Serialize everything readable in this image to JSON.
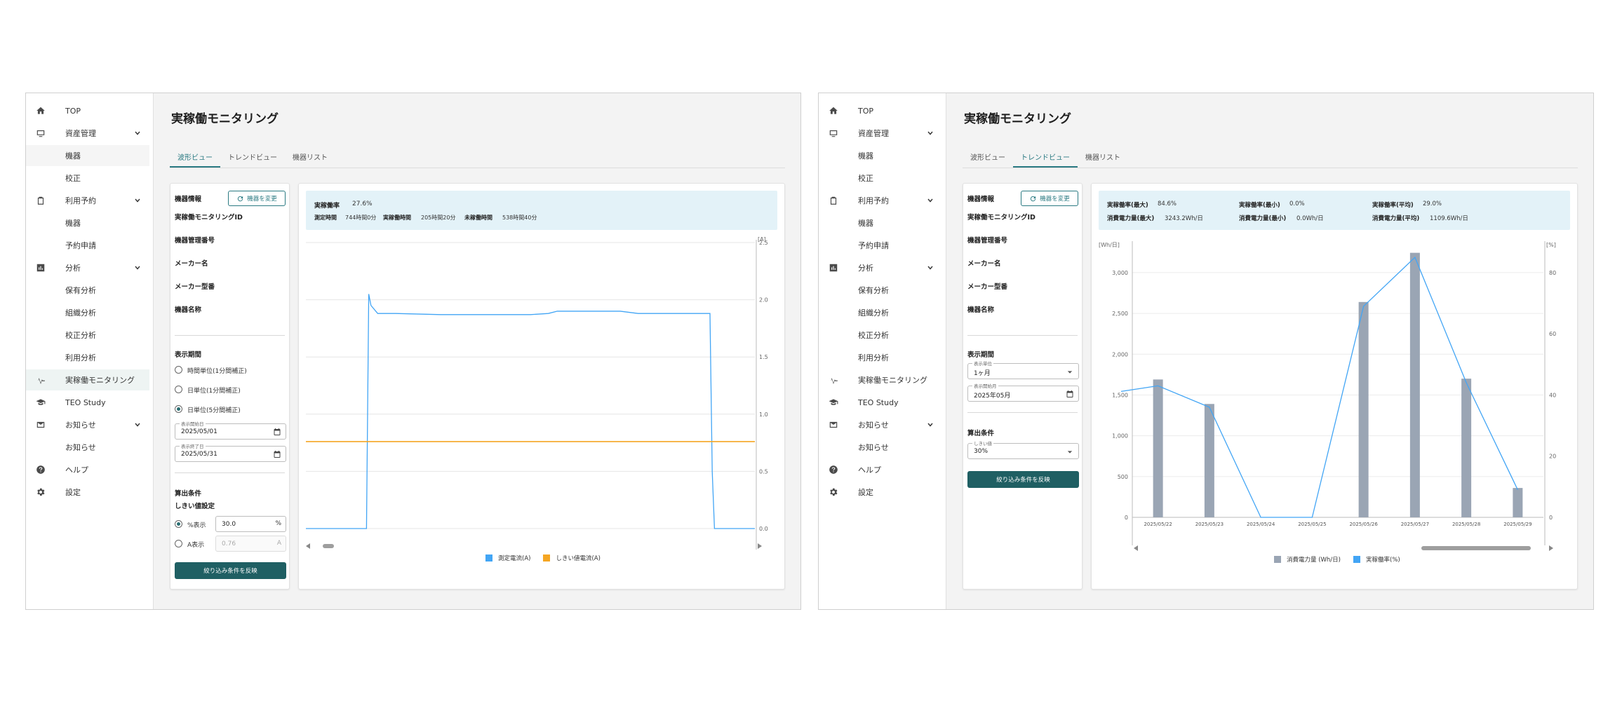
{
  "sidebar": {
    "items": [
      {
        "label": "TOP",
        "icon": "home-icon"
      },
      {
        "label": "資産管理",
        "icon": "asset-icon",
        "expandable": true
      },
      {
        "label": "機器"
      },
      {
        "label": "校正"
      },
      {
        "label": "利用予約",
        "icon": "clipboard-icon",
        "expandable": true
      },
      {
        "label": "機器"
      },
      {
        "label": "予約申請"
      },
      {
        "label": "分析",
        "icon": "analytics-icon",
        "expandable": true
      },
      {
        "label": "保有分析"
      },
      {
        "label": "組織分析"
      },
      {
        "label": "校正分析"
      },
      {
        "label": "利用分析"
      },
      {
        "label": "実稼働モニタリング",
        "icon": "monitoring-icon"
      },
      {
        "label": "TEO Study",
        "icon": "graduation-cap-icon"
      },
      {
        "label": "お知らせ",
        "icon": "mail-icon",
        "expandable": true
      },
      {
        "label": "お知らせ"
      },
      {
        "label": "ヘルプ",
        "icon": "help-icon"
      },
      {
        "label": "設定",
        "icon": "gear-icon"
      }
    ]
  },
  "page_title": "実稼働モニタリング",
  "tabs": [
    "波形ビュー",
    "トレンドビュー",
    "機器リスト"
  ],
  "device_info": {
    "title": "機器情報",
    "change_button": "機器を変更",
    "fields": [
      "実稼働モニタリングID",
      "機器管理番号",
      "メーカー名",
      "メーカー型番",
      "機器名称"
    ]
  },
  "left_screen": {
    "period": {
      "title": "表示期間",
      "options": [
        "時間単位(1分間補正)",
        "日単位(1分間補正)",
        "日単位(5分間補正)"
      ],
      "selected_index": 2,
      "start_label": "表示開始日",
      "start_value": "2025/05/01",
      "end_label": "表示終了日",
      "end_value": "2025/05/31"
    },
    "calc": {
      "title": "算出条件",
      "subtitle": "しきい値設定",
      "percent_label": "%表示",
      "percent_value": "30.0",
      "percent_unit": "%",
      "amp_label": "A表示",
      "amp_value": "0.76",
      "amp_unit": "A"
    },
    "apply_button": "絞り込み条件を反映",
    "summary": {
      "rate_label": "実稼働率",
      "rate_value": "27.6%",
      "measure_label": "測定時間",
      "measure_value": "744時間0分",
      "active_label": "実稼働時間",
      "active_value": "205時間20分",
      "inactive_label": "未稼働時間",
      "inactive_value": "538時間40分"
    },
    "legend": [
      {
        "label": "測定電流(A)",
        "color": "#42a5f5"
      },
      {
        "label": "しきい値電流(A)",
        "color": "#f5a623"
      }
    ]
  },
  "right_screen": {
    "period": {
      "title": "表示期間",
      "unit_label": "表示単位",
      "unit_value": "1ヶ月",
      "start_label": "表示開始月",
      "start_value": "2025年05月"
    },
    "calc": {
      "title": "算出条件",
      "threshold_label": "しきい値",
      "threshold_value": "30%"
    },
    "apply_button": "絞り込み条件を反映",
    "summary": [
      {
        "label": "実稼働率(最大)",
        "value": "84.6%"
      },
      {
        "label": "実稼働率(最小)",
        "value": "0.0%"
      },
      {
        "label": "実稼働率(平均)",
        "value": "29.0%"
      },
      {
        "label": "消費電力量(最大)",
        "value": "3243.2Wh/日"
      },
      {
        "label": "消費電力量(最小)",
        "value": "0.0Wh/日"
      },
      {
        "label": "消費電力量(平均)",
        "value": "1109.6Wh/日"
      }
    ],
    "legend": [
      {
        "label": "消費電力量 (Wh/日)",
        "color": "#9aa5b4"
      },
      {
        "label": "実稼働率(%)",
        "color": "#42a5f5"
      }
    ]
  },
  "chart_data": [
    {
      "type": "line",
      "ylabel": "[A]",
      "ylim": [
        0,
        2.5
      ],
      "yticks": [
        "0.0",
        "0.5",
        "1.0",
        "1.5",
        "2.0",
        "2.5"
      ],
      "grid": true,
      "series": [
        {
          "name": "測定電流(A)",
          "color": "#42a5f5",
          "x": [
            0,
            0.135,
            0.14,
            0.145,
            0.16,
            0.2,
            0.3,
            0.4,
            0.5,
            0.54,
            0.56,
            0.7,
            0.72,
            0.74,
            0.88,
            0.9,
            0.905,
            0.91,
            1.0
          ],
          "values": [
            0.0,
            0.0,
            2.05,
            1.95,
            1.88,
            1.88,
            1.87,
            1.87,
            1.87,
            1.88,
            1.9,
            1.9,
            1.89,
            1.88,
            1.88,
            1.88,
            0.5,
            0.0,
            0.0
          ]
        },
        {
          "name": "しきい値電流(A)",
          "color": "#f5a623",
          "x": [
            0,
            1
          ],
          "values": [
            0.76,
            0.76
          ]
        }
      ]
    },
    {
      "type": "bar",
      "categories": [
        "2025/05/22",
        "2025/05/23",
        "2025/05/24",
        "2025/05/25",
        "2025/05/26",
        "2025/05/27",
        "2025/05/28",
        "2025/05/29"
      ],
      "ylabel": "[Wh/日]",
      "y2label": "[%]",
      "ylim": [
        0,
        3300
      ],
      "y2lim": [
        0,
        88
      ],
      "yticks": [
        "0",
        "500",
        "1,000",
        "1,500",
        "2,000",
        "2,500",
        "3,000"
      ],
      "y2ticks": [
        "0",
        "20",
        "40",
        "60",
        "80"
      ],
      "series": [
        {
          "name": "消費電力量 (Wh/日)",
          "type": "bar",
          "color": "#9aa5b4",
          "values": [
            1690,
            1390,
            0,
            0,
            2640,
            3243,
            1700,
            360
          ]
        },
        {
          "name": "実稼働率(%)",
          "type": "line",
          "color": "#42a5f5",
          "values": [
            43,
            36,
            0,
            0,
            69,
            85,
            44,
            9
          ]
        }
      ]
    }
  ]
}
